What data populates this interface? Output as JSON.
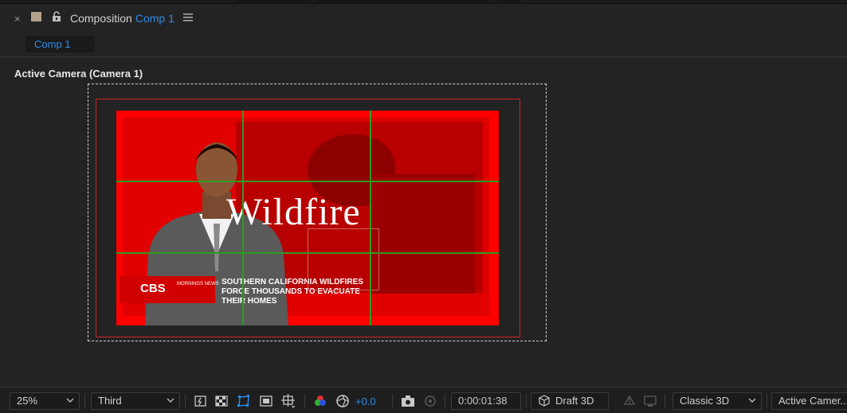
{
  "panel": {
    "title_prefix": "Composition",
    "comp_name": "Comp 1",
    "tab_label": "Comp 1",
    "swatch_color": "#b3a28a",
    "accent_color": "#2d8ceb"
  },
  "viewer": {
    "view_label": "Active Camera (Camera 1)",
    "footage": {
      "headline": "Wildfire",
      "logo_text": "CBS",
      "logo_subtext": "MORNINGS NEWS",
      "ticker_text": "SOUTHERN CALIFORNIA WILDFIRES FORCE THOUSANDS TO EVACUATE THEIR HOMES"
    }
  },
  "toolbar": {
    "zoom_value": "25%",
    "resolution_value": "Third",
    "exposure_value": "+0.0",
    "timecode": "0:00:01:38",
    "draft3d_label": "Draft 3D",
    "renderer_value": "Classic 3D",
    "view_value": "Active Camer..."
  }
}
